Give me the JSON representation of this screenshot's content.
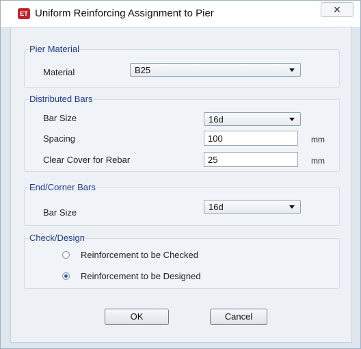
{
  "window": {
    "title": "Uniform Reinforcing Assignment to Pier",
    "app_icon_text": "ET",
    "close_glyph": "✕"
  },
  "pier_material": {
    "group_label": "Pier Material",
    "material_label": "Material",
    "material_value": "B25"
  },
  "distributed_bars": {
    "group_label": "Distributed Bars",
    "bar_size_label": "Bar Size",
    "bar_size_value": "16d",
    "spacing_label": "Spacing",
    "spacing_value": "100",
    "spacing_unit": "mm",
    "clear_cover_label": "Clear Cover for Rebar",
    "clear_cover_value": "25",
    "clear_cover_unit": "mm"
  },
  "end_corner_bars": {
    "group_label": "End/Corner Bars",
    "bar_size_label": "Bar Size",
    "bar_size_value": "16d"
  },
  "check_design": {
    "group_label": "Check/Design",
    "options": [
      {
        "label": "Reinforcement to be Checked",
        "selected": false
      },
      {
        "label": "Reinforcement to be Designed",
        "selected": true
      }
    ]
  },
  "buttons": {
    "ok": "OK",
    "cancel": "Cancel"
  },
  "colors": {
    "group_label": "#1e3a8a",
    "radio_selected": "#2a5db0",
    "icon_red": "#c0242a"
  }
}
